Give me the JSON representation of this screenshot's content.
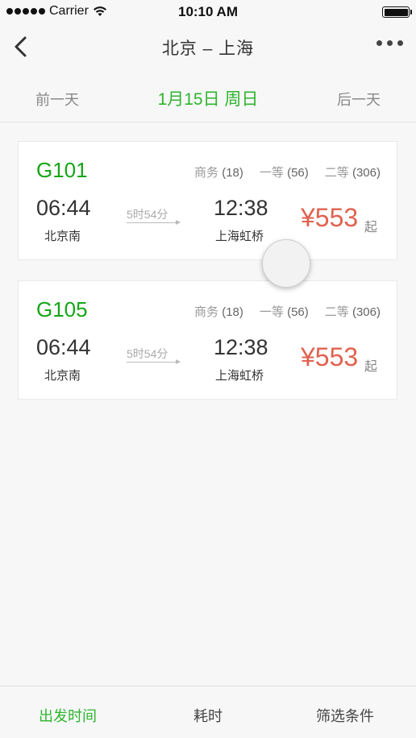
{
  "status_bar": {
    "carrier": "Carrier",
    "time": "10:10 AM",
    "icons": [
      "signal-icon",
      "wifi-icon",
      "battery-icon"
    ]
  },
  "nav": {
    "title": "北京 – 上海",
    "back_icon": "chevron-left-icon",
    "more_icon": "more-horizontal-icon"
  },
  "date_bar": {
    "prev_label": "前一天",
    "current_date": "1月15日 周日",
    "next_label": "后一天"
  },
  "trains": [
    {
      "number": "G101",
      "seats": [
        {
          "class": "商务",
          "count": "(18)"
        },
        {
          "class": "一等",
          "count": "(56)"
        },
        {
          "class": "二等",
          "count": "(306)"
        }
      ],
      "departure_time": "06:44",
      "departure_station": "北京南",
      "duration": "5时54分",
      "arrival_time": "12:38",
      "arrival_station": "上海虹桥",
      "price": "¥553",
      "price_suffix": "起"
    },
    {
      "number": "G105",
      "seats": [
        {
          "class": "商务",
          "count": "(18)"
        },
        {
          "class": "一等",
          "count": "(56)"
        },
        {
          "class": "二等",
          "count": "(306)"
        }
      ],
      "departure_time": "06:44",
      "departure_station": "北京南",
      "duration": "5时54分",
      "arrival_time": "12:38",
      "arrival_station": "上海虹桥",
      "price": "¥553",
      "price_suffix": "起"
    }
  ],
  "tabs": [
    {
      "label": "出发时间",
      "active": true
    },
    {
      "label": "耗时",
      "active": false
    },
    {
      "label": "筛选条件",
      "active": false
    }
  ],
  "colors": {
    "accent_green": "#2db52d",
    "train_number_green": "#16a516",
    "price_red": "#e0624f",
    "background": "#f7f7f7"
  }
}
